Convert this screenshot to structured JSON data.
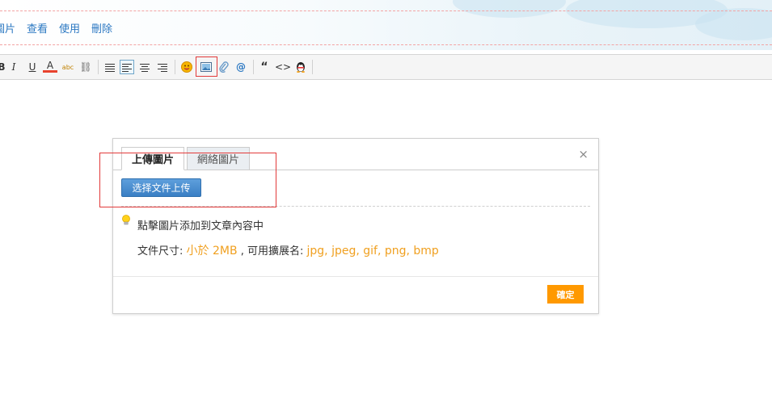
{
  "top_links": [
    "圖片",
    "查看",
    "使用",
    "刪除"
  ],
  "toolbar": {
    "items": [
      {
        "name": "italic-button",
        "glyph": "I"
      },
      {
        "name": "underline-button",
        "glyph": "U"
      },
      {
        "name": "font-color-button",
        "glyph": "A"
      },
      {
        "name": "background-color-button",
        "glyph": "abc"
      },
      {
        "name": "link-button",
        "glyph": "⛓"
      }
    ],
    "align": [
      {
        "name": "align-left-button",
        "glyph": "≡"
      },
      {
        "name": "align-center-button",
        "glyph": "≡"
      },
      {
        "name": "align-right-button",
        "glyph": "≡"
      }
    ],
    "insert": [
      {
        "name": "emoji-button",
        "glyph": "☻"
      },
      {
        "name": "image-button",
        "glyph": "▣"
      },
      {
        "name": "attachment-button",
        "glyph": "🖇"
      },
      {
        "name": "at-mention-button",
        "glyph": "@"
      }
    ],
    "quote_glyph": "“",
    "code_glyph": "<>",
    "qq_glyph": "☺"
  },
  "dialog": {
    "tab_upload": "上傳圖片",
    "tab_web": "網絡圖片",
    "close_glyph": "×",
    "upload_button": "选择文件上传",
    "hint": "點擊圖片添加到文章內容中",
    "size_label": "文件尺寸:",
    "size_value": "小於 2MB",
    "ext_label": ", 可用擴展名:",
    "ext_value": "jpg, jpeg, gif, png, bmp",
    "ok_button": "確定"
  },
  "colors": {
    "link": "#2b78c2",
    "accent_orange": "#ff9900",
    "info_orange": "#f0a020",
    "upload_blue": "#3a7fc4",
    "annotation_red": "#e23a3a"
  }
}
